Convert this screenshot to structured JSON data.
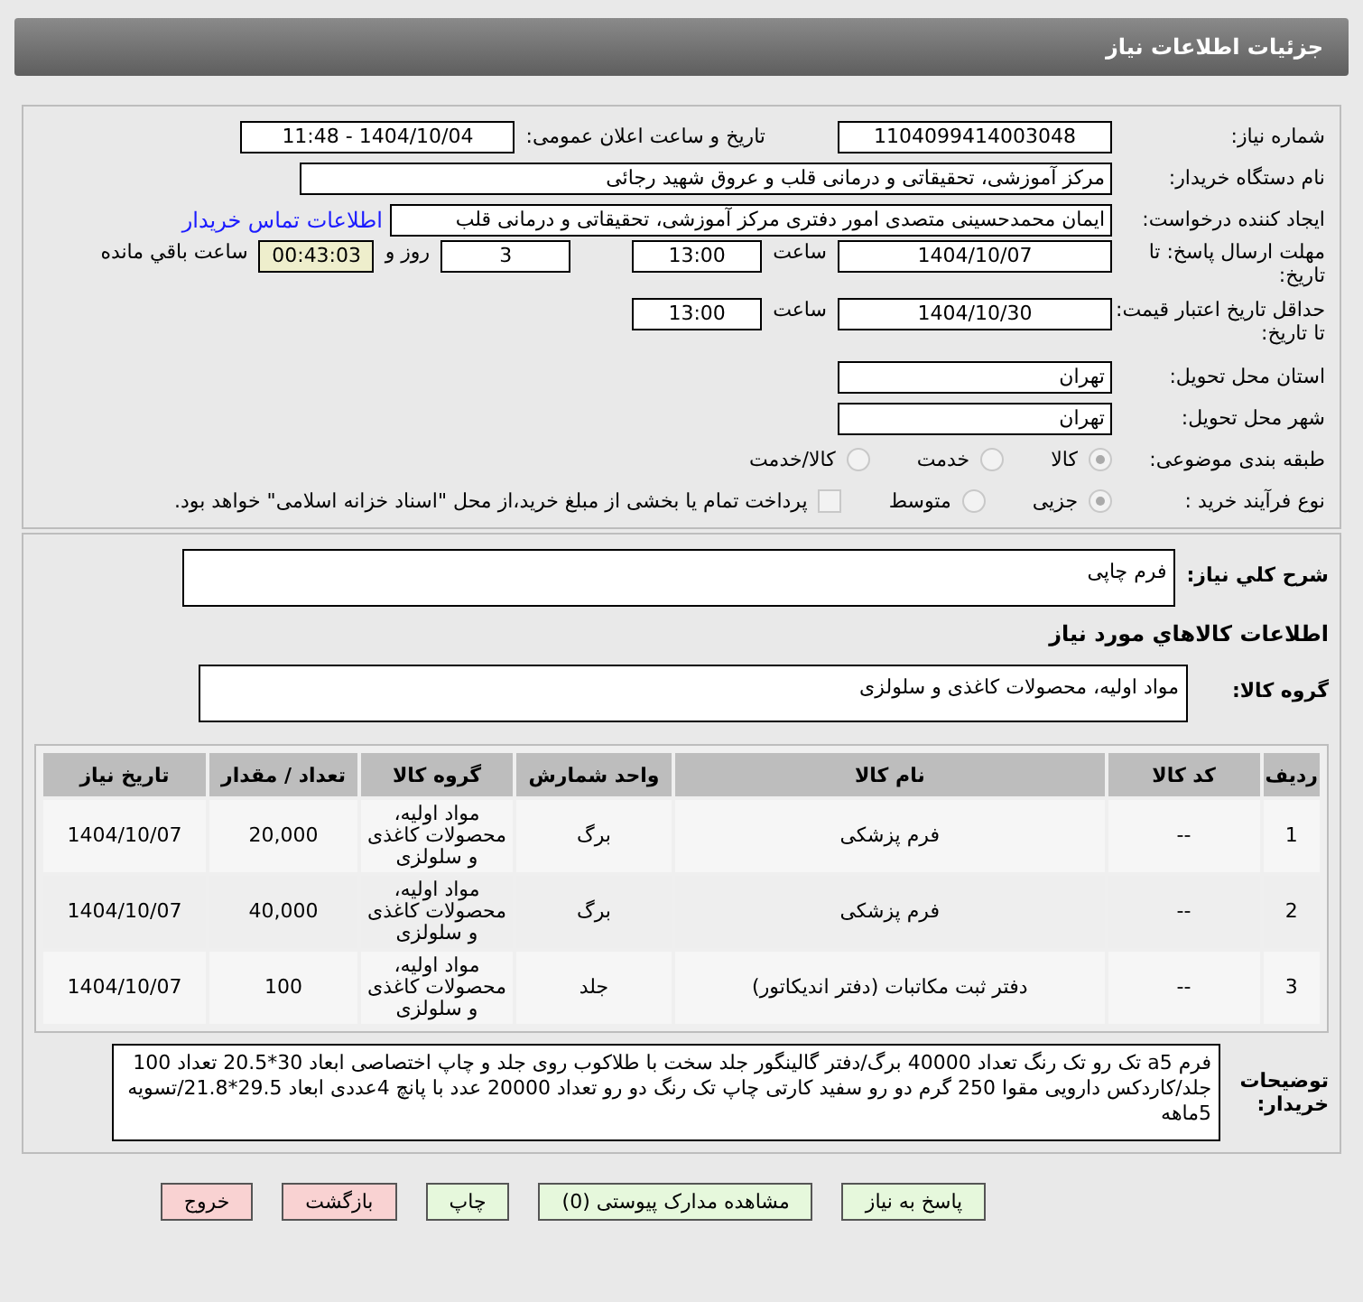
{
  "window": {
    "title": "جزئیات اطلاعات نیاز"
  },
  "need_number": {
    "label": "شماره نیاز:",
    "value": "1104099414003048"
  },
  "announce": {
    "label": "تاریخ و ساعت اعلان عمومی:",
    "value": "1404/10/04 - 11:48"
  },
  "buyer": {
    "label": "نام دستگاه خریدار:",
    "value": "مرکز آموزشی، تحقیقاتی و درمانی قلب و عروق شهید رجائی"
  },
  "creator": {
    "label": "ایجاد کننده درخواست:",
    "value": "ایمان محمدحسینی متصدی امور دفتری مرکز آموزشی، تحقیقاتی و درمانی قلب",
    "link": "اطلاعات تماس خریدار"
  },
  "reply_deadline": {
    "label": "مهلت ارسال پاسخ: تا تاریخ:",
    "date": "1404/10/07",
    "time_label": "ساعت",
    "time": "13:00",
    "days": "3",
    "days_label": "روز و",
    "remaining": "00:43:03",
    "remaining_label": "ساعت باقي مانده"
  },
  "price_validity": {
    "label": "حداقل تاریخ اعتبار قیمت: تا تاریخ:",
    "date": "1404/10/30",
    "time_label": "ساعت",
    "time": "13:00"
  },
  "province": {
    "label": "استان محل تحویل:",
    "value": "تهران"
  },
  "city": {
    "label": "شهر محل تحویل:",
    "value": "تهران"
  },
  "category": {
    "label": "طبقه بندی موضوعی:",
    "options": [
      {
        "label": "کالا",
        "selected": true
      },
      {
        "label": "خدمت",
        "selected": false
      },
      {
        "label": "کالا/خدمت",
        "selected": false
      }
    ]
  },
  "process": {
    "label": "نوع فرآیند خرید :",
    "options": [
      {
        "label": "جزیی",
        "selected": true
      },
      {
        "label": "متوسط",
        "selected": false
      }
    ],
    "checkbox": {
      "label": "پرداخت تمام یا بخشی از مبلغ خرید،از محل \"اسناد خزانه اسلامی\" خواهد بود.",
      "checked": false
    }
  },
  "description": {
    "label": "شرح کلي نياز:",
    "value": "فرم چاپی"
  },
  "goods_heading": "اطلاعات كالاهاي مورد نياز",
  "goods_group": {
    "label": "گروه کالا:",
    "value": "مواد اولیه، محصولات کاغذی و سلولزی"
  },
  "table": {
    "columns": [
      "ردیف",
      "کد کالا",
      "نام کالا",
      "واحد شمارش",
      "گروه کالا",
      "تعداد / مقدار",
      "تاریخ نیاز"
    ],
    "rows": [
      [
        "1",
        "--",
        "فرم پزشکی",
        "برگ",
        "مواد اولیه، محصولات کاغذی و سلولزی",
        "20,000",
        "1404/10/07"
      ],
      [
        "2",
        "--",
        "فرم پزشکی",
        "برگ",
        "مواد اولیه، محصولات کاغذی و سلولزی",
        "40,000",
        "1404/10/07"
      ],
      [
        "3",
        "--",
        "دفتر ثبت مکاتبات (دفتر اندیکاتور)",
        "جلد",
        "مواد اولیه، محصولات کاغذی و سلولزی",
        "100",
        "1404/10/07"
      ]
    ]
  },
  "buyer_notes": {
    "label": "توضیحات خریدار:",
    "value": "فرم a5 تک رو تک رنگ تعداد 40000 برگ/دفتر گالینگور جلد سخت با طلاکوب روی جلد و چاپ اختصاصی ابعاد 30*20.5 تعداد 100 جلد/کاردکس دارویی مقوا 250 گرم دو رو سفید کارتی چاپ تک رنگ دو رو تعداد 20000 عدد با پانچ 4عددی ابعاد 29.5*21.8/تسویه 5ماهه"
  },
  "buttons": [
    {
      "label": "پاسخ به نیاز",
      "kind": "go"
    },
    {
      "label": "مشاهده مدارک پیوستی (0)",
      "kind": "go"
    },
    {
      "label": "چاپ",
      "kind": "go"
    },
    {
      "label": "بازگشت",
      "kind": "stop"
    },
    {
      "label": "خروج",
      "kind": "stop"
    }
  ]
}
